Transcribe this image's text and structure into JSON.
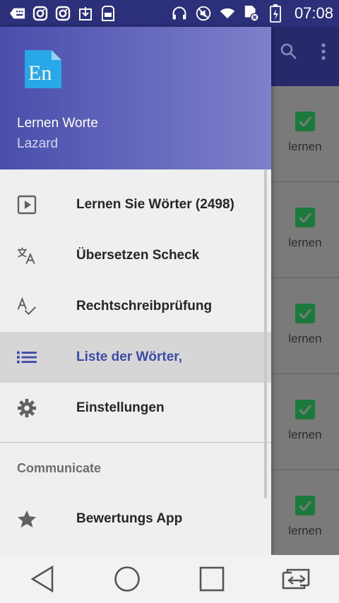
{
  "status_bar": {
    "time": "07:08",
    "icons": [
      "keyboard-icon",
      "instagram-icon",
      "instagram-icon",
      "download-icon",
      "storage-icon",
      "headphones-icon",
      "mute-icon",
      "wifi-icon",
      "sim-icon",
      "battery-icon"
    ]
  },
  "toolbar": {
    "icons": [
      "search-icon",
      "more-vert-icon"
    ]
  },
  "background_list": {
    "rows": [
      {
        "label": "lernen"
      },
      {
        "label": "lernen"
      },
      {
        "label": "lernen"
      },
      {
        "label": "lernen"
      },
      {
        "label": "lernen"
      }
    ]
  },
  "drawer": {
    "header": {
      "logo_text": "En",
      "title": "Lernen Worte",
      "subtitle": "Lazard"
    },
    "items": [
      {
        "label": "Lernen Sie Wörter (2498)",
        "icon": "play-box-icon",
        "active": false
      },
      {
        "label": "Übersetzen Scheck",
        "icon": "translate-icon",
        "active": false
      },
      {
        "label": "Rechtschreibprüfung",
        "icon": "spellcheck-icon",
        "active": false
      },
      {
        "label": "Liste der Wörter,",
        "icon": "list-icon",
        "active": true
      },
      {
        "label": "Einstellungen",
        "icon": "gear-icon",
        "active": false
      }
    ],
    "section": {
      "label": "Communicate",
      "items": [
        {
          "label": "Bewertungs App",
          "icon": "star-icon"
        }
      ]
    }
  },
  "colors": {
    "accent": "#3e4aa8",
    "status_bar": "#2c2f7a",
    "header_start": "#4a4eab",
    "header_end": "#7e80cb",
    "check": "#1a7a3c"
  },
  "navigation_bar": {
    "buttons": [
      "back-icon",
      "home-icon",
      "recents-icon",
      "switch-icon"
    ]
  }
}
